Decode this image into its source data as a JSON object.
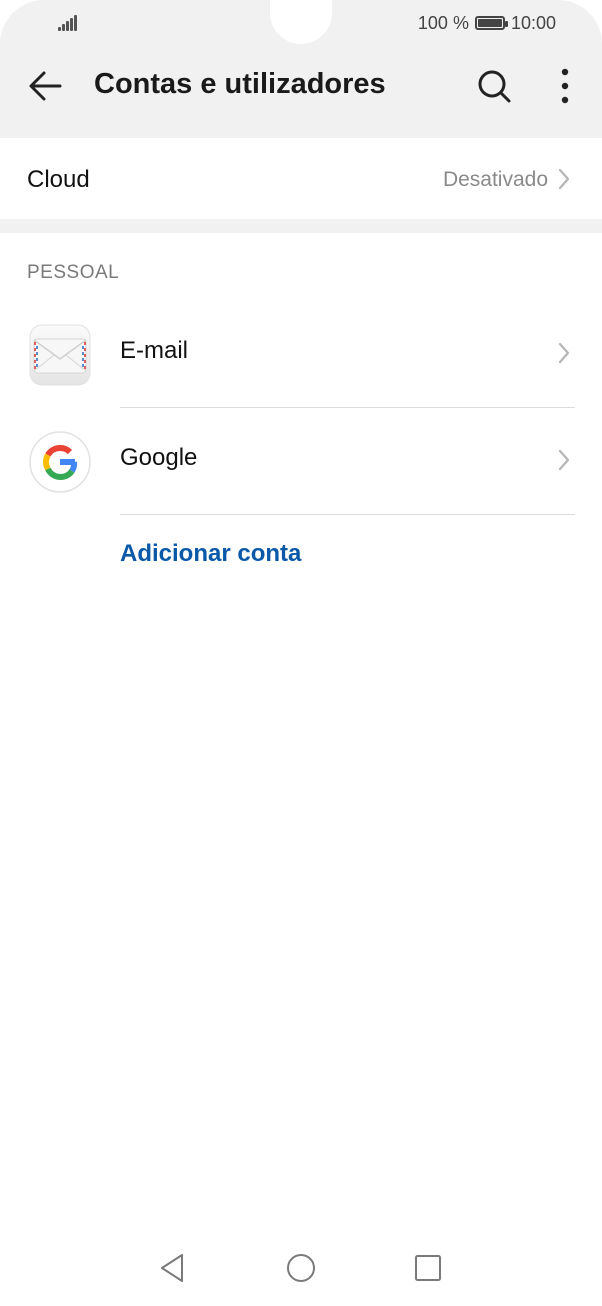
{
  "status_bar": {
    "battery_percent": "100 %",
    "time": "10:00"
  },
  "app_bar": {
    "title": "Contas e utilizadores"
  },
  "cloud": {
    "label": "Cloud",
    "value": "Desativado"
  },
  "section": {
    "header": "PESSOAL",
    "accounts": [
      {
        "label": "E-mail",
        "icon": "envelope-icon"
      },
      {
        "label": "Google",
        "icon": "google-icon"
      }
    ],
    "add_account_label": "Adicionar conta"
  },
  "colors": {
    "accent": "#0a59a8",
    "top_background": "#f1f1f1"
  }
}
